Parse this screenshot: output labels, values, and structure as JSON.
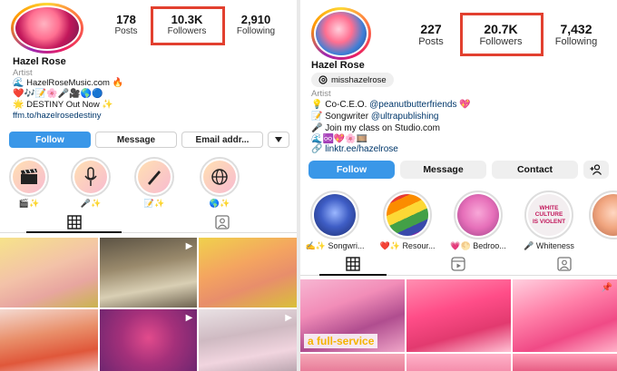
{
  "left": {
    "stats": {
      "posts": {
        "value": "178",
        "label": "Posts"
      },
      "followers": {
        "value": "10.3K",
        "label": "Followers"
      },
      "following": {
        "value": "2,910",
        "label": "Following"
      }
    },
    "name": "Hazel Rose",
    "category": "Artist",
    "bio": {
      "line1": "HazelRoseMusic.com",
      "line3": "DESTINY Out Now",
      "link": "ffm.to/hazelrosedestiny"
    },
    "buttons": {
      "follow": "Follow",
      "message": "Message",
      "email": "Email addr..."
    },
    "tabs": [
      "grid-icon",
      "tagged-icon"
    ]
  },
  "right": {
    "stats": {
      "posts": {
        "value": "227",
        "label": "Posts"
      },
      "followers": {
        "value": "20.7K",
        "label": "Followers"
      },
      "following": {
        "value": "7,432",
        "label": "Following"
      }
    },
    "name": "Hazel Rose",
    "handle": "misshazelrose",
    "category": "Artist",
    "bio": {
      "line1_prefix": "Co-C.E.O.",
      "line1_mention": "@peanutbutterfriends",
      "line2_prefix": "Songwriter",
      "line2_mention": "@ultrapublishing",
      "line3": "Join my class on Studio.com",
      "link": "linktr.ee/hazelrose"
    },
    "buttons": {
      "follow": "Follow",
      "message": "Message",
      "contact": "Contact"
    },
    "highlights": [
      {
        "caption": "Songwri..."
      },
      {
        "caption": "Resour..."
      },
      {
        "caption": "Bedroo..."
      },
      {
        "caption": "Whiteness",
        "text": "WHITE CULTURE IS VIOLENT"
      },
      {
        "caption": ""
      }
    ],
    "grid_caption": "a full-service"
  },
  "colors": {
    "highlight_box": "#e2402f",
    "follow_blue": "#3a97e8",
    "link": "#00376b"
  }
}
